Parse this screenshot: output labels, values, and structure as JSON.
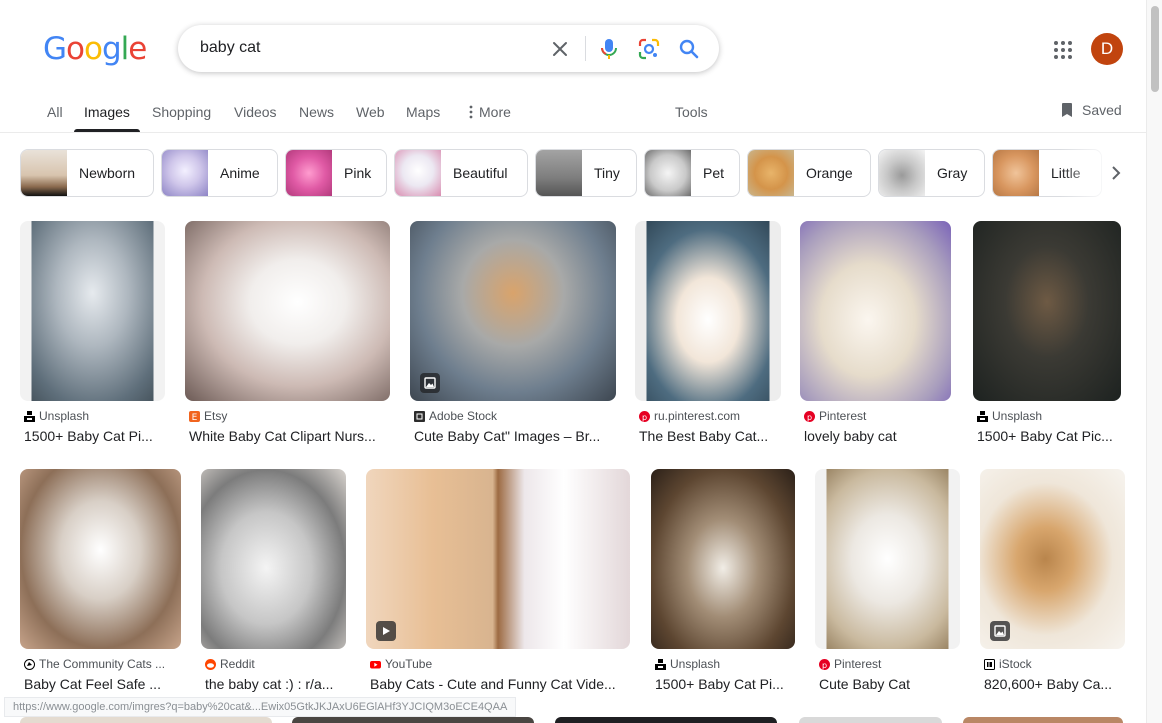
{
  "logo": {
    "letters": [
      "G",
      "o",
      "o",
      "g",
      "l",
      "e"
    ],
    "colors": [
      "#4285f4",
      "#ea4335",
      "#fbbc05",
      "#4285f4",
      "#34a853",
      "#ea4335"
    ]
  },
  "search": {
    "query": "baby cat",
    "icons": [
      "close-icon",
      "mic-icon",
      "lens-icon",
      "search-icon"
    ]
  },
  "account": {
    "initial": "D",
    "color": "#c1440e"
  },
  "tabs": [
    "All",
    "Images",
    "Shopping",
    "Videos",
    "News",
    "Web",
    "Maps",
    "More",
    "Tools"
  ],
  "active_tab": "Images",
  "saved_label": "Saved",
  "chips": [
    "Newborn",
    "Anime",
    "Pink",
    "Beautiful",
    "Tiny",
    "Pet",
    "Orange",
    "Gray",
    "Little"
  ],
  "results_row1": [
    {
      "source": "Unsplash",
      "title": "1500+ Baby Cat Pi...",
      "fav_color": "#000000",
      "icon": "unsplash-icon"
    },
    {
      "source": "Etsy",
      "title": "White Baby Cat Clipart Nurs...",
      "fav_color": "#f1641e",
      "icon": "etsy-icon"
    },
    {
      "source": "Adobe Stock",
      "title": "Cute Baby Cat\" Images – Br...",
      "fav_color": "#2c2c2c",
      "icon": "adobe-stock-icon"
    },
    {
      "source": "ru.pinterest.com",
      "title": "The Best Baby Cat...",
      "fav_color": "#e60023",
      "icon": "pinterest-icon"
    },
    {
      "source": "Pinterest",
      "title": "lovely baby cat",
      "fav_color": "#e60023",
      "icon": "pinterest-icon"
    },
    {
      "source": "Unsplash",
      "title": "1500+ Baby Cat Pic...",
      "fav_color": "#000000",
      "icon": "unsplash-icon"
    }
  ],
  "results_row2": [
    {
      "source": "The Community Cats ...",
      "title": "Baby Cat Feel Safe ...",
      "fav_color": "#000000",
      "icon": "community-cats-icon"
    },
    {
      "source": "Reddit",
      "title": "the baby cat :) : r/a...",
      "fav_color": "#ff4500",
      "icon": "reddit-icon"
    },
    {
      "source": "YouTube",
      "title": "Baby Cats - Cute and Funny Cat Vide...",
      "fav_color": "#ff0000",
      "icon": "youtube-icon"
    },
    {
      "source": "Unsplash",
      "title": "1500+ Baby Cat Pi...",
      "fav_color": "#000000",
      "icon": "unsplash-icon"
    },
    {
      "source": "Pinterest",
      "title": "Cute Baby Cat",
      "fav_color": "#e60023",
      "icon": "pinterest-icon"
    },
    {
      "source": "iStock",
      "title": "820,600+ Baby Ca...",
      "fav_color": "#000000",
      "icon": "istock-icon"
    }
  ],
  "status_url": "https://www.google.com/imgres?q=baby%20cat&...Ewix05GtkJKJAxU6EGlAHf3YJCIQM3oECE4QAA"
}
